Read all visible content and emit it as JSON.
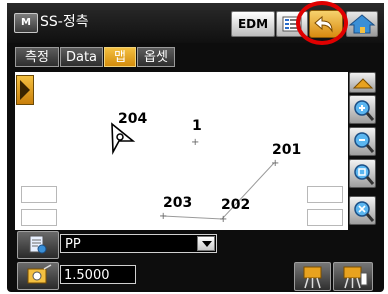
{
  "title": "SS-정측",
  "app_icon_letter": "M",
  "toolbar": {
    "edm_label": "EDM"
  },
  "tabs": [
    {
      "label": "측정",
      "active": false
    },
    {
      "label": "Data",
      "active": false
    },
    {
      "label": "맵",
      "active": true
    },
    {
      "label": "옵셋",
      "active": false
    }
  ],
  "map": {
    "points": [
      {
        "label": "204"
      },
      {
        "label": "1"
      },
      {
        "label": "201"
      },
      {
        "label": "203"
      },
      {
        "label": "202"
      }
    ]
  },
  "code_field": {
    "value": "PP"
  },
  "height_field": {
    "value": "1.5000"
  },
  "colors": {
    "accent": "#e8a21f",
    "highlight_ring": "#e00000",
    "background": "#0d0d0d"
  },
  "icons": [
    "menu-icon",
    "list-icon",
    "back-arrow-icon",
    "home-icon",
    "expand-arrow-icon",
    "pan-up-icon",
    "zoom-in-icon",
    "zoom-out-icon",
    "zoom-extent-icon",
    "zoom-all-icon",
    "code-lookup-icon",
    "target-height-icon",
    "survey-tool-icon",
    "survey-tool-2-icon"
  ]
}
